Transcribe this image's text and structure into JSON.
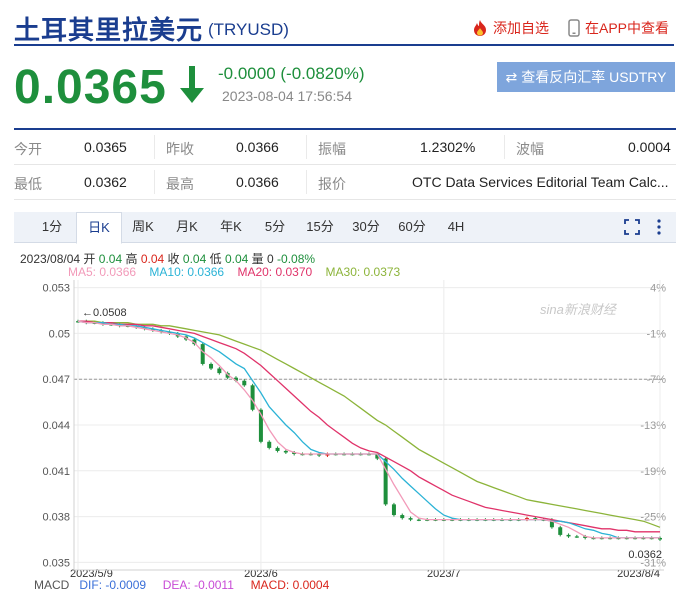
{
  "header": {
    "title": "土耳其里拉美元",
    "code": "(TRYUSD)",
    "add_favorite": "添加自选",
    "view_in_app": "在APP中查看"
  },
  "quote": {
    "price": "0.0365",
    "change": "-0.0000 (-0.0820%)",
    "time": "2023-08-04 17:56:54",
    "reverse_button": "查看反向汇率 USDTRY"
  },
  "stats": {
    "row1": [
      {
        "label": "今开",
        "value": "0.0365"
      },
      {
        "label": "昨收",
        "value": "0.0366"
      },
      {
        "label": "振幅",
        "value": "1.2302%"
      },
      {
        "label": "波幅",
        "value": "0.0004"
      }
    ],
    "row2": [
      {
        "label": "最低",
        "value": "0.0362"
      },
      {
        "label": "最高",
        "value": "0.0366"
      },
      {
        "label": "报价",
        "value": "OTC Data Services Editorial Team Calc..."
      }
    ]
  },
  "tabs": [
    "1分",
    "日K",
    "周K",
    "月K",
    "年K",
    "5分",
    "15分",
    "30分",
    "60分",
    "4H"
  ],
  "active_tab": "日K",
  "bar_info": {
    "date": "2023/08/04",
    "open_label": "开",
    "open": "0.04",
    "high_label": "高",
    "high": "0.04",
    "close_label": "收",
    "close": "0.04",
    "low_label": "低",
    "low": "0.04",
    "vol_label": "量",
    "vol": "0",
    "pct": "-0.08%"
  },
  "ma": [
    {
      "label": "MA5: 0.0366",
      "color": "#f29ab9"
    },
    {
      "label": "MA10: 0.0366",
      "color": "#2bb3d6"
    },
    {
      "label": "MA20: 0.0370",
      "color": "#e0336a"
    },
    {
      "label": "MA30: 0.0373",
      "color": "#8cb43a"
    }
  ],
  "macd": {
    "title": "MACD",
    "dif": "DIF: -0.0009",
    "dea": "DEA: -0.0011",
    "macd": "MACD: 0.0004"
  },
  "chart_data": {
    "type": "candlestick",
    "y_ticks": [
      "0.053",
      "0.05",
      "0.047",
      "0.044",
      "0.041",
      "0.038",
      "0.035"
    ],
    "y_tick_values": [
      0.053,
      0.05,
      0.047,
      0.044,
      0.041,
      0.038,
      0.035
    ],
    "pct_ticks": [
      "4%",
      "-1%",
      "-7%",
      "-13%",
      "-19%",
      "-25%",
      "-31%"
    ],
    "x_labels": [
      "2023/5/9",
      "2023/6",
      "2023/7",
      "2023/8/4"
    ],
    "ylim": [
      0.0345,
      0.0535
    ],
    "annotation_high": "0.0508",
    "annotation_last": "0.0362",
    "watermark": "sina新浪财经",
    "close_series": [
      0.0508,
      0.0507,
      0.0507,
      0.0506,
      0.0506,
      0.0505,
      0.0505,
      0.0504,
      0.0503,
      0.0502,
      0.0501,
      0.05,
      0.0498,
      0.0496,
      0.0493,
      0.048,
      0.0477,
      0.0474,
      0.0471,
      0.0469,
      0.0466,
      0.045,
      0.0429,
      0.0425,
      0.0423,
      0.0422,
      0.0421,
      0.0421,
      0.0421,
      0.042,
      0.0421,
      0.0421,
      0.0421,
      0.0421,
      0.0421,
      0.0421,
      0.0418,
      0.0388,
      0.0381,
      0.0379,
      0.0378,
      0.0378,
      0.0378,
      0.0378,
      0.0378,
      0.0378,
      0.0378,
      0.0378,
      0.0378,
      0.0378,
      0.0378,
      0.0378,
      0.0378,
      0.0378,
      0.0379,
      0.0378,
      0.0378,
      0.0373,
      0.0368,
      0.0367,
      0.0367,
      0.0366,
      0.0366,
      0.0366,
      0.0366,
      0.0366,
      0.0366,
      0.0366,
      0.0366,
      0.0366,
      0.0365
    ],
    "ma5": [
      0.0508,
      0.0507,
      0.0507,
      0.0506,
      0.0506,
      0.0505,
      0.0505,
      0.0504,
      0.0503,
      0.0502,
      0.0501,
      0.05,
      0.0499,
      0.0497,
      0.0494,
      0.0488,
      0.0484,
      0.0479,
      0.0473,
      0.0469,
      0.0463,
      0.0456,
      0.0447,
      0.0437,
      0.0429,
      0.0424,
      0.0422,
      0.0421,
      0.0421,
      0.0421,
      0.0421,
      0.0421,
      0.0421,
      0.0421,
      0.0421,
      0.0421,
      0.0421,
      0.0411,
      0.0401,
      0.0392,
      0.0383,
      0.0379,
      0.0378,
      0.0378,
      0.0378,
      0.0378,
      0.0378,
      0.0378,
      0.0378,
      0.0378,
      0.0378,
      0.0378,
      0.0378,
      0.0378,
      0.0378,
      0.0378,
      0.0378,
      0.0377,
      0.0375,
      0.0373,
      0.037,
      0.0367,
      0.0366,
      0.0366,
      0.0366,
      0.0366,
      0.0366,
      0.0366,
      0.0366,
      0.0366,
      0.0366
    ],
    "ma10": [
      0.0508,
      0.0507,
      0.0507,
      0.0507,
      0.0506,
      0.0506,
      0.0505,
      0.0505,
      0.0504,
      0.0503,
      0.0502,
      0.0501,
      0.05,
      0.0499,
      0.0497,
      0.0494,
      0.0491,
      0.0488,
      0.0484,
      0.048,
      0.0477,
      0.0469,
      0.0461,
      0.0452,
      0.0446,
      0.044,
      0.0435,
      0.0429,
      0.0424,
      0.0422,
      0.0421,
      0.0421,
      0.0421,
      0.0421,
      0.0421,
      0.0421,
      0.0421,
      0.0416,
      0.0411,
      0.0405,
      0.04,
      0.0395,
      0.039,
      0.0385,
      0.0381,
      0.0379,
      0.0378,
      0.0378,
      0.0378,
      0.0378,
      0.0378,
      0.0378,
      0.0378,
      0.0378,
      0.0378,
      0.0378,
      0.0378,
      0.0377,
      0.0377,
      0.0376,
      0.0374,
      0.0372,
      0.0371,
      0.0369,
      0.0368,
      0.0366,
      0.0366,
      0.0366,
      0.0366,
      0.0366,
      0.0366
    ],
    "ma20": [
      0.0508,
      0.0508,
      0.0507,
      0.0507,
      0.0507,
      0.0506,
      0.0506,
      0.0506,
      0.0505,
      0.0505,
      0.0504,
      0.0503,
      0.0502,
      0.0501,
      0.05,
      0.0498,
      0.0496,
      0.0494,
      0.0492,
      0.049,
      0.0487,
      0.0483,
      0.0479,
      0.0474,
      0.0469,
      0.0464,
      0.0459,
      0.0454,
      0.0449,
      0.0445,
      0.044,
      0.0436,
      0.0432,
      0.0428,
      0.0425,
      0.0423,
      0.0422,
      0.0419,
      0.0416,
      0.0413,
      0.041,
      0.0406,
      0.0403,
      0.04,
      0.0397,
      0.0394,
      0.0392,
      0.039,
      0.0388,
      0.0386,
      0.0385,
      0.0384,
      0.0383,
      0.0382,
      0.0381,
      0.038,
      0.0379,
      0.0378,
      0.0377,
      0.0376,
      0.0375,
      0.0374,
      0.0373,
      0.0372,
      0.0372,
      0.0371,
      0.0371,
      0.037,
      0.037,
      0.037,
      0.037
    ],
    "ma30": [
      0.0508,
      0.0508,
      0.0508,
      0.0507,
      0.0507,
      0.0507,
      0.0507,
      0.0506,
      0.0506,
      0.0506,
      0.0505,
      0.0505,
      0.0504,
      0.0503,
      0.0502,
      0.0501,
      0.05,
      0.0499,
      0.0497,
      0.0495,
      0.0493,
      0.0491,
      0.0489,
      0.0486,
      0.0483,
      0.048,
      0.0477,
      0.0474,
      0.0471,
      0.0468,
      0.0465,
      0.0462,
      0.0459,
      0.0455,
      0.0451,
      0.0447,
      0.0443,
      0.044,
      0.0436,
      0.0432,
      0.0428,
      0.0424,
      0.0421,
      0.0418,
      0.0415,
      0.0412,
      0.0409,
      0.0406,
      0.0403,
      0.0401,
      0.0399,
      0.0397,
      0.0395,
      0.0393,
      0.0391,
      0.039,
      0.0389,
      0.0388,
      0.0387,
      0.0386,
      0.0385,
      0.0384,
      0.0383,
      0.0382,
      0.0381,
      0.038,
      0.0379,
      0.0378,
      0.0377,
      0.0375,
      0.0373
    ]
  },
  "colors": {
    "up": "#d9261c",
    "down": "#1e8f3c",
    "brand": "#1a3d8f"
  },
  "icons": [
    "flame-icon",
    "phone-icon",
    "swap-icon",
    "fullscreen-icon",
    "more-icon",
    "down-arrow-icon"
  ]
}
